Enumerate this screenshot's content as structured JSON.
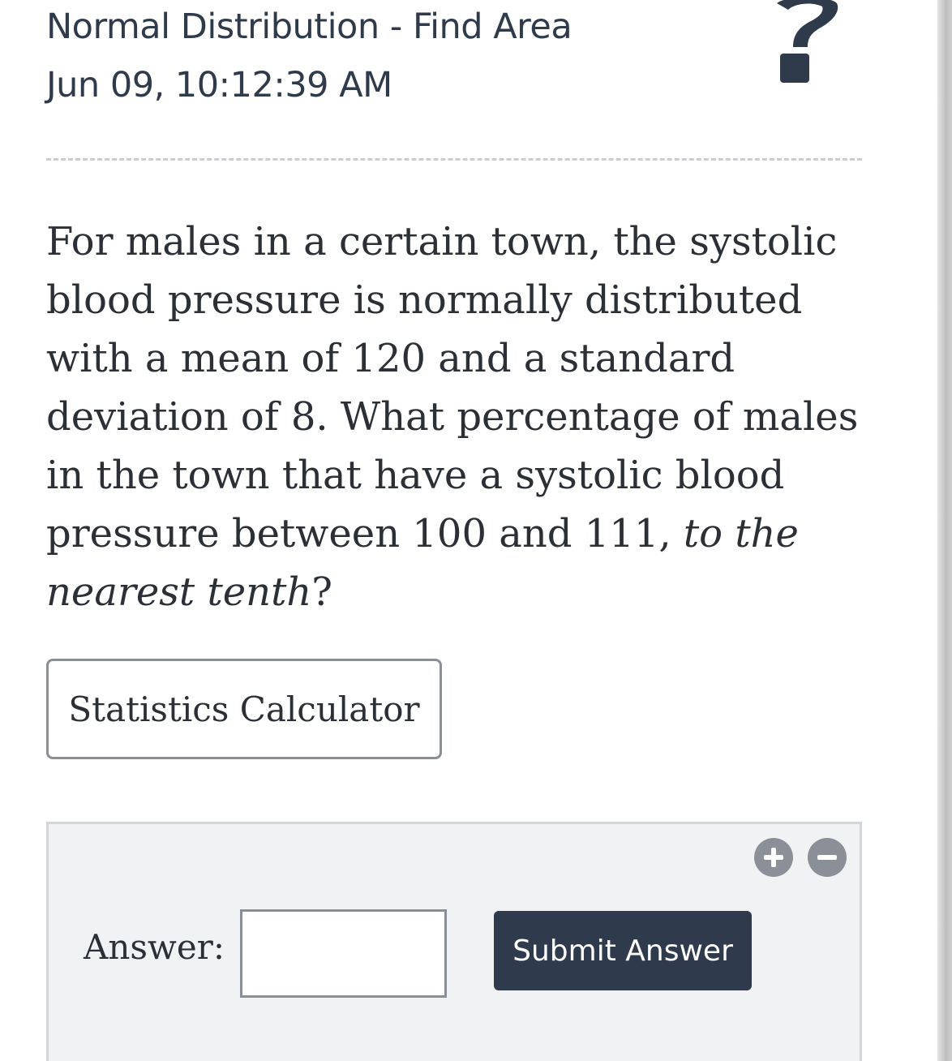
{
  "header": {
    "title": "Normal Distribution - Find Area",
    "timestamp": "Jun 09, 10:12:39 AM"
  },
  "question": {
    "text_before": "For males in a certain town, the systolic blood pressure is normally distributed with a mean of 120 and a standard deviation of 8. What percentage of males in the town that have a systolic blood pressure between 100 and 111, ",
    "emphasis": "to the nearest tenth",
    "text_after": "?"
  },
  "buttons": {
    "calculator": "Statistics Calculator",
    "submit": "Submit Answer"
  },
  "answer": {
    "label": "Answer:",
    "value": ""
  },
  "icons": {
    "help": "help-question-icon",
    "zoom_in": "zoom-in-icon",
    "zoom_out": "zoom-out-icon"
  },
  "colors": {
    "text_dark": "#2f3a4a",
    "button_dark": "#2f3b4c",
    "icon_gray": "#8b9098",
    "panel_bg": "#f1f2f4"
  }
}
